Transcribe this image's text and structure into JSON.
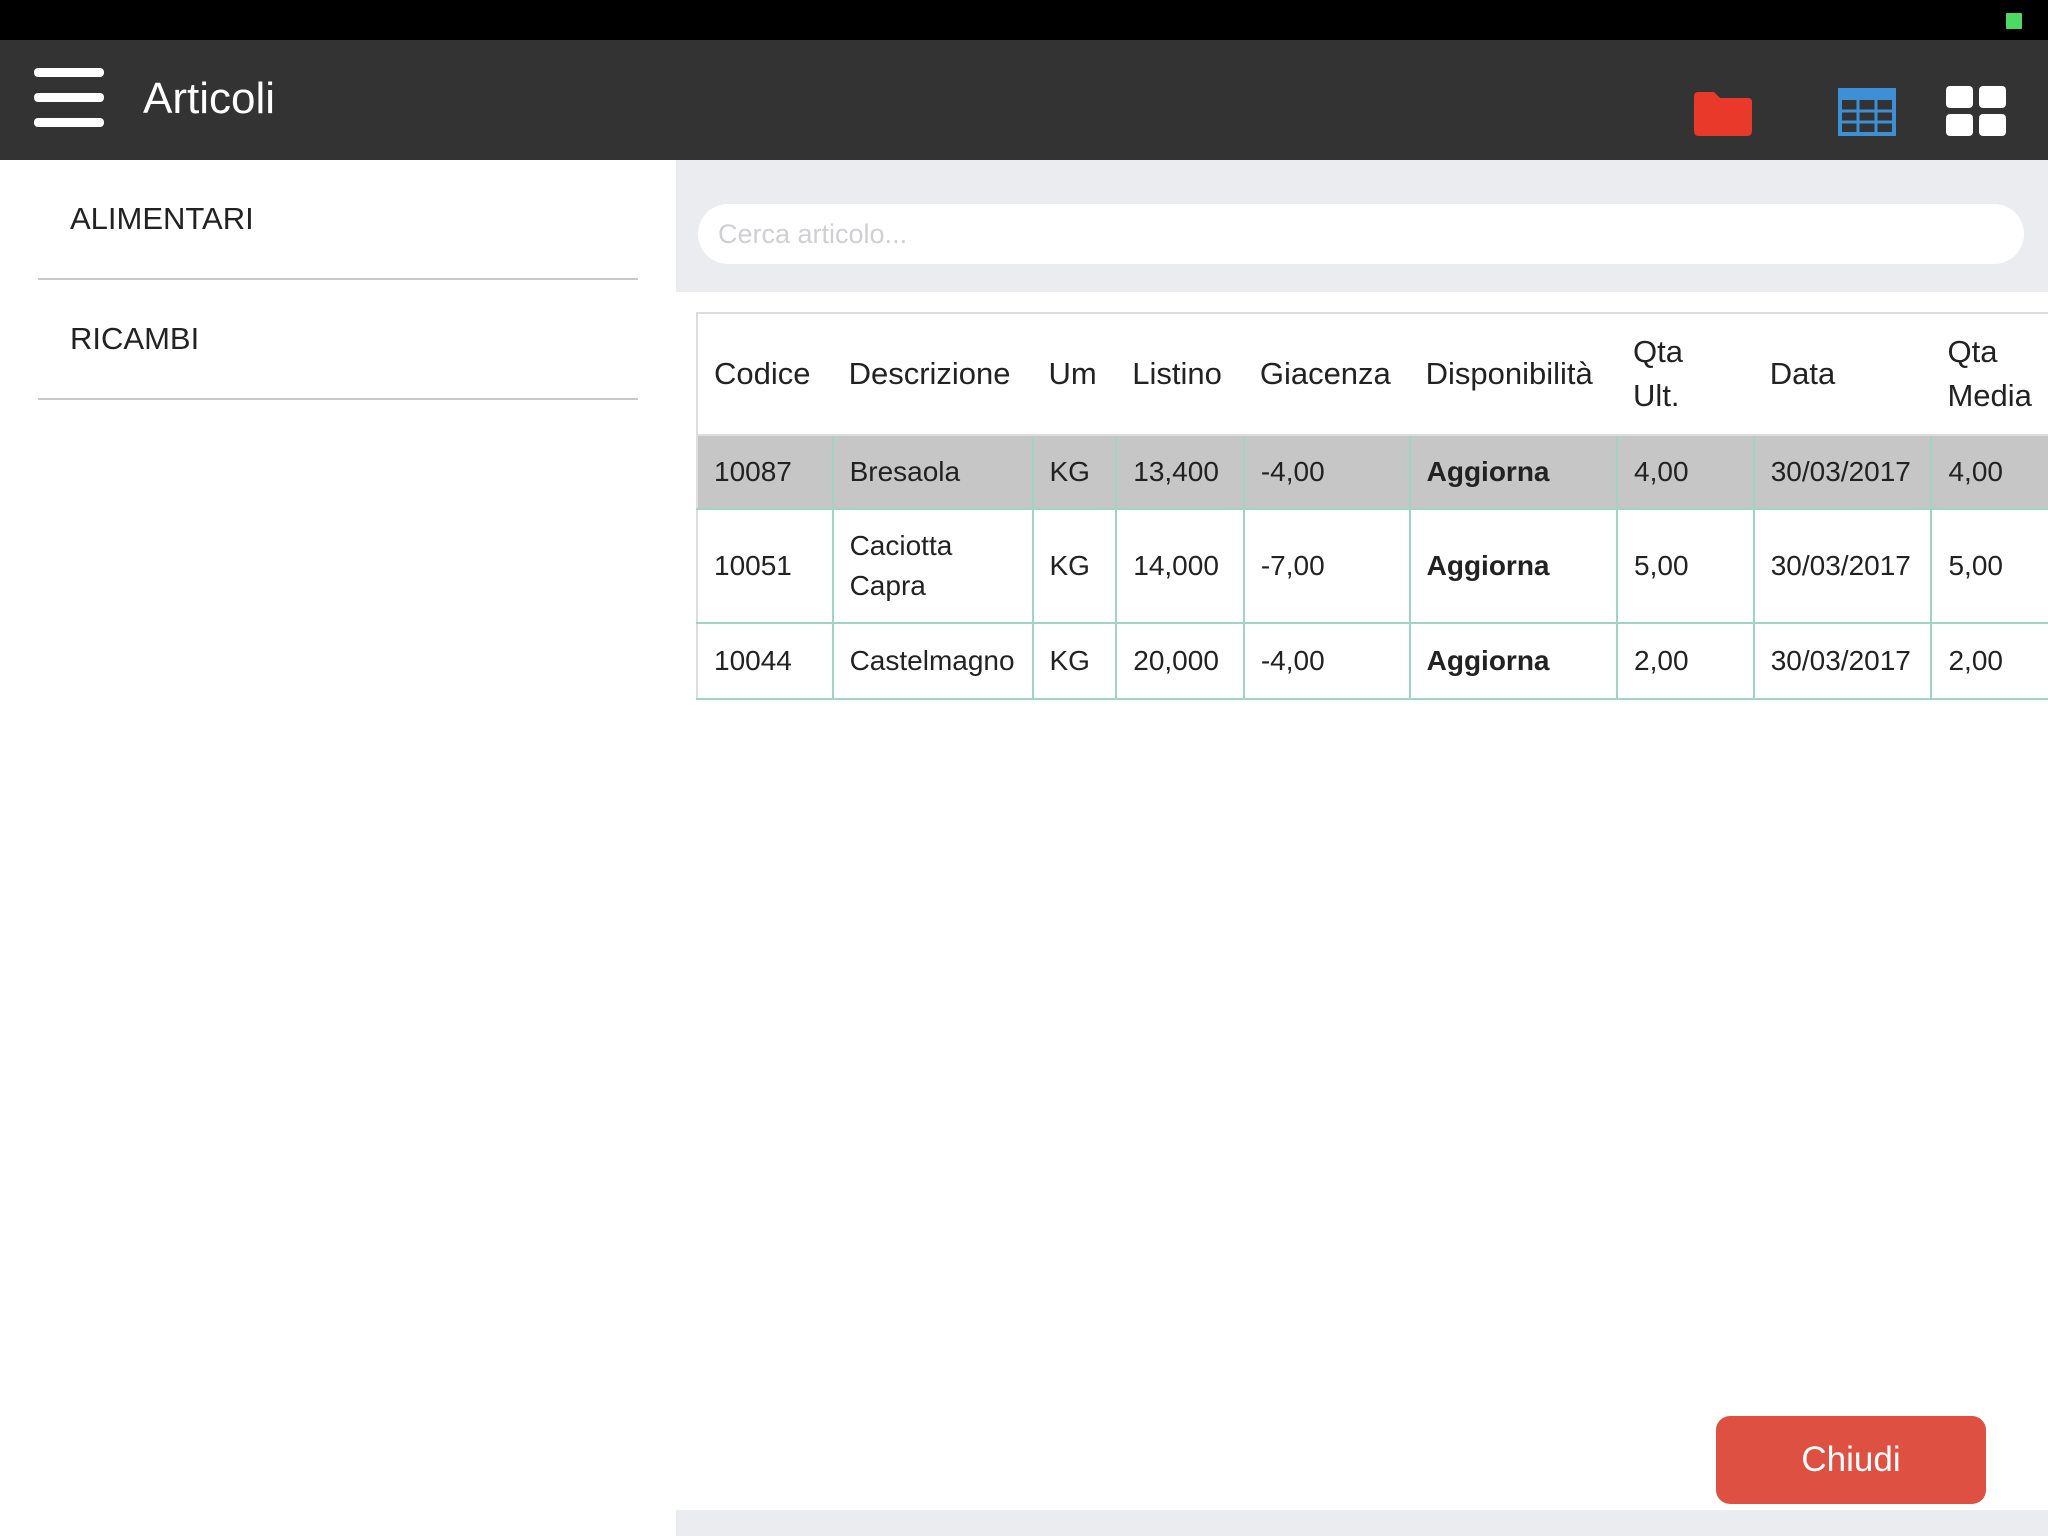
{
  "header": {
    "title": "Articoli",
    "menu_icon": "hamburger-menu-icon",
    "icons": [
      "folder-icon",
      "table-view-icon",
      "grid-view-icon"
    ],
    "colors": {
      "bar": "#333333",
      "folder": "#e8392b",
      "table": "#3d8fd6",
      "grid": "#ffffff"
    }
  },
  "sidebar": {
    "items": [
      {
        "label": "ALIMENTARI"
      },
      {
        "label": "RICAMBI"
      }
    ]
  },
  "search": {
    "placeholder": "Cerca articolo..."
  },
  "table": {
    "columns": [
      {
        "line1": "Codice",
        "line2": ""
      },
      {
        "line1": "Descrizione",
        "line2": ""
      },
      {
        "line1": "Um",
        "line2": ""
      },
      {
        "line1": "Listino",
        "line2": ""
      },
      {
        "line1": "Giacenza",
        "line2": ""
      },
      {
        "line1": "Disponibilità",
        "line2": ""
      },
      {
        "line1": "Qta",
        "line2": "Ult."
      },
      {
        "line1": "Data",
        "line2": ""
      },
      {
        "line1": "Qta",
        "line2": "Media"
      }
    ],
    "rows": [
      {
        "codice": "10087",
        "descrizione": [
          "Bresaola",
          ""
        ],
        "um": "KG",
        "listino": "13,400",
        "giacenza": "-4,00",
        "disponibilita": "Aggiorna",
        "qta_ult": "4,00",
        "data": "30/03/2017",
        "qta_media": "4,00",
        "selected": true
      },
      {
        "codice": "10051",
        "descrizione": [
          "Caciotta",
          "Capra"
        ],
        "um": "KG",
        "listino": "14,000",
        "giacenza": "-7,00",
        "disponibilita": "Aggiorna",
        "qta_ult": "5,00",
        "data": "30/03/2017",
        "qta_media": "5,00",
        "selected": false
      },
      {
        "codice": "10044",
        "descrizione": [
          "Castelmagno",
          ""
        ],
        "um": "KG",
        "listino": "20,000",
        "giacenza": "-4,00",
        "disponibilita": "Aggiorna",
        "qta_ult": "2,00",
        "data": "30/03/2017",
        "qta_media": "2,00",
        "selected": false
      }
    ]
  },
  "footer": {
    "close_label": "Chiudi",
    "close_color": "#de5041"
  }
}
